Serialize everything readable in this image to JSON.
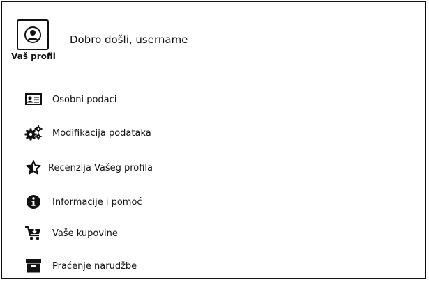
{
  "header": {
    "profile_label": "Vaš profil",
    "welcome_text": "Dobro došli, username"
  },
  "menu": {
    "items": [
      {
        "label": "Osobni podaci",
        "icon": "id-card-icon"
      },
      {
        "label": "Modifikacija podataka",
        "icon": "gears-icon"
      },
      {
        "label": "Recenzija Vašeg profila",
        "icon": "star-half-icon"
      },
      {
        "label": "Informacije i pomoć",
        "icon": "info-icon"
      },
      {
        "label": "Vaše kupovine",
        "icon": "cart-icon"
      },
      {
        "label": "Praćenje narudžbe",
        "icon": "archive-box-icon"
      }
    ]
  },
  "colors": {
    "ink": "#111111",
    "background": "#ffffff"
  }
}
